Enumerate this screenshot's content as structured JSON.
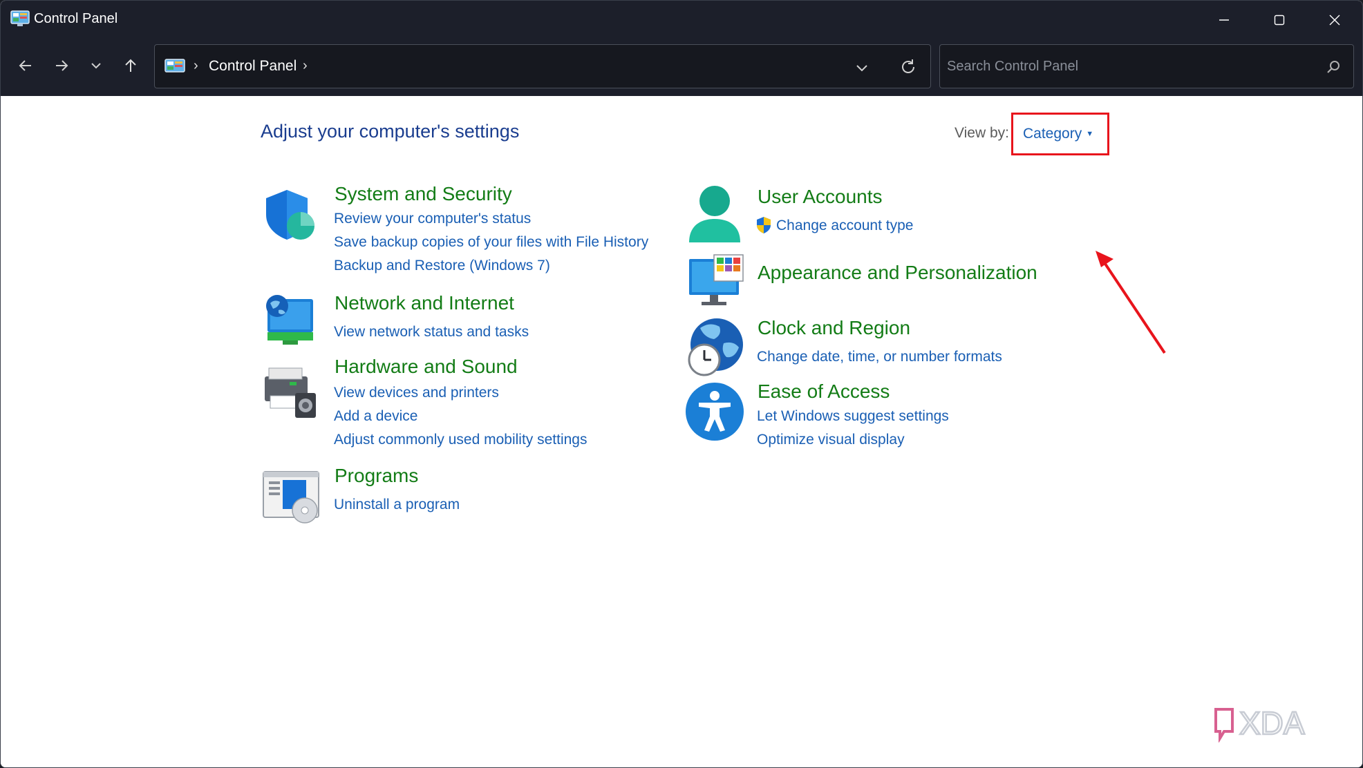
{
  "window": {
    "title": "Control Panel"
  },
  "address_bar": {
    "path": "Control Panel",
    "separator": "›"
  },
  "search": {
    "placeholder": "Search Control Panel",
    "value": ""
  },
  "content": {
    "heading": "Adjust your computer's settings",
    "view_by": {
      "label": "View by:",
      "selected": "Category"
    },
    "categories": [
      {
        "title": "System and Security",
        "icon": "shield-icon",
        "links": [
          "Review your computer's status",
          "Save backup copies of your files with File History",
          "Backup and Restore (Windows 7)"
        ]
      },
      {
        "title": "Network and Internet",
        "icon": "network-globe-icon",
        "links": [
          "View network status and tasks"
        ]
      },
      {
        "title": "Hardware and Sound",
        "icon": "printer-speaker-icon",
        "links": [
          "View devices and printers",
          "Add a device",
          "Adjust commonly used mobility settings"
        ]
      },
      {
        "title": "Programs",
        "icon": "programs-disc-icon",
        "links": [
          "Uninstall a program"
        ]
      },
      {
        "title": "User Accounts",
        "icon": "user-icon",
        "links": [
          "Change account type"
        ]
      },
      {
        "title": "Appearance and Personalization",
        "icon": "monitor-palette-icon",
        "links": []
      },
      {
        "title": "Clock and Region",
        "icon": "globe-clock-icon",
        "links": [
          "Change date, time, or number formats"
        ]
      },
      {
        "title": "Ease of Access",
        "icon": "accessibility-icon",
        "links": [
          "Let Windows suggest settings",
          "Optimize visual display"
        ]
      }
    ]
  },
  "watermark": {
    "text": "XDA"
  },
  "colors": {
    "titlebar": "#1c1f2a",
    "heading": "#1a3d8f",
    "category_title": "#137c16",
    "link": "#1a5fb4",
    "highlight_box": "#e8141c"
  }
}
